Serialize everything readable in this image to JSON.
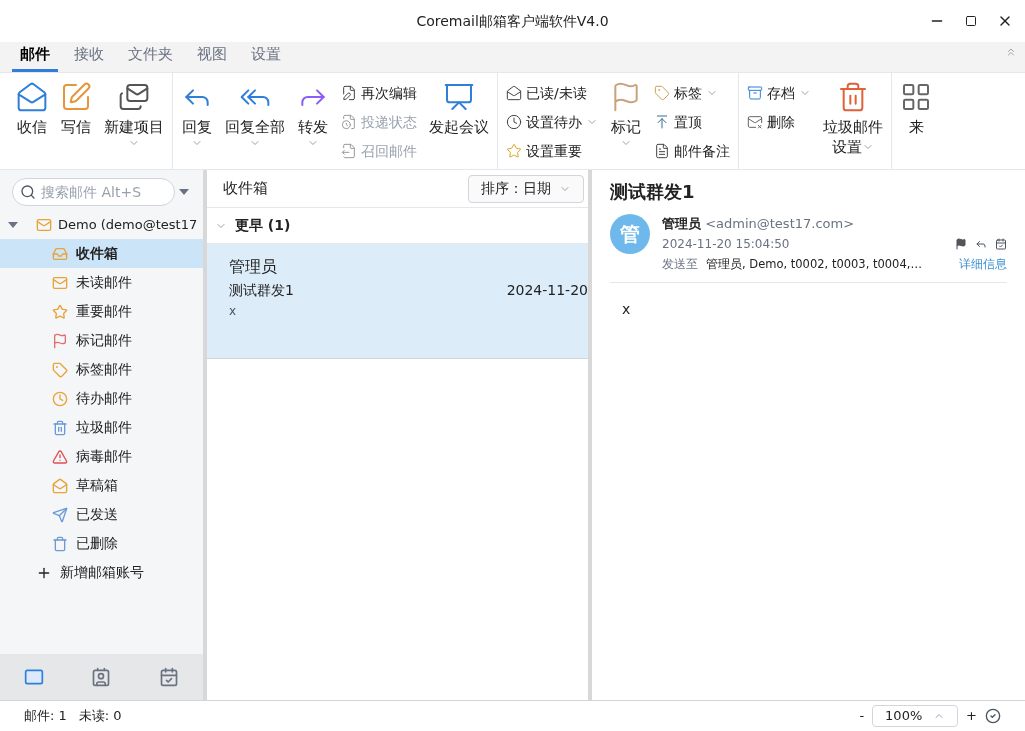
{
  "window": {
    "title": "Coremail邮箱客户端软件V4.0"
  },
  "tabs": [
    {
      "label": "邮件",
      "selected": true
    },
    {
      "label": "接收",
      "selected": false
    },
    {
      "label": "文件夹",
      "selected": false
    },
    {
      "label": "视图",
      "selected": false
    },
    {
      "label": "设置",
      "selected": false
    }
  ],
  "ribbon": [
    [
      {
        "kind": "big",
        "label": "收信",
        "dropdown": false
      },
      {
        "kind": "big",
        "label": "写信",
        "dropdown": false
      },
      {
        "kind": "big",
        "label": "新建项目",
        "dropdown": true
      }
    ],
    [
      {
        "kind": "big",
        "label": "回复",
        "dropdown": true
      },
      {
        "kind": "big",
        "label": "回复全部",
        "dropdown": true
      },
      {
        "kind": "big",
        "label": "转发",
        "dropdown": true
      },
      {
        "kind": "stack",
        "items": [
          {
            "label": "再次编辑",
            "disabled": false,
            "dropdown": false
          },
          {
            "label": "投递状态",
            "disabled": true,
            "dropdown": false
          },
          {
            "label": "召回邮件",
            "disabled": true,
            "dropdown": false
          }
        ]
      },
      {
        "kind": "big",
        "label": "发起会议",
        "dropdown": false
      }
    ],
    [
      {
        "kind": "stack",
        "items": [
          {
            "label": "已读/未读",
            "disabled": false,
            "dropdown": false
          },
          {
            "label": "设置待办",
            "disabled": false,
            "dropdown": true
          },
          {
            "label": "设置重要",
            "disabled": false,
            "dropdown": false
          }
        ]
      },
      {
        "kind": "big",
        "label": "标记",
        "dropdown": true
      },
      {
        "kind": "stack",
        "items": [
          {
            "label": "标签",
            "disabled": false,
            "dropdown": true
          },
          {
            "label": "置顶",
            "disabled": false,
            "dropdown": false
          },
          {
            "label": "邮件备注",
            "disabled": false,
            "dropdown": false
          }
        ]
      }
    ],
    [
      {
        "kind": "stack",
        "items": [
          {
            "label": "存档",
            "disabled": false,
            "dropdown": true
          },
          {
            "label": "删除",
            "disabled": false,
            "dropdown": false
          }
        ]
      },
      {
        "kind": "big",
        "label": "垃圾邮件",
        "label2": "设置",
        "dropdown": true
      }
    ],
    [
      {
        "kind": "big",
        "label": "来",
        "dropdown": false
      }
    ]
  ],
  "sidebar": {
    "search": {
      "placeholder": "搜索邮件 Alt+S"
    },
    "account": {
      "label": "Demo (demo@test17",
      "expanded": true
    },
    "folders": [
      {
        "label": "收件箱",
        "selected": true
      },
      {
        "label": "未读邮件",
        "selected": false
      },
      {
        "label": "重要邮件",
        "selected": false
      },
      {
        "label": "标记邮件",
        "selected": false
      },
      {
        "label": "标签邮件",
        "selected": false
      },
      {
        "label": "待办邮件",
        "selected": false
      },
      {
        "label": "垃圾邮件",
        "selected": false
      },
      {
        "label": "病毒邮件",
        "selected": false
      },
      {
        "label": "草稿箱",
        "selected": false
      },
      {
        "label": "已发送",
        "selected": false
      },
      {
        "label": "已删除",
        "selected": false
      }
    ],
    "add_account": "新增邮箱账号",
    "nav": [
      {
        "selected": true
      },
      {
        "selected": false
      },
      {
        "selected": false
      }
    ]
  },
  "message_list": {
    "title": "收件箱",
    "sort": "排序：日期",
    "group": {
      "label": "更早 (1)",
      "expanded": true
    },
    "messages": [
      {
        "sender": "管理员",
        "subject": "测试群发1",
        "date": "2024-11-20",
        "preview": "x",
        "selected": true
      }
    ]
  },
  "reader": {
    "subject": "测试群发1",
    "avatar": "管",
    "sender": "管理员",
    "email": "<admin@test17.com>",
    "time": "2024-11-20 15:04:50",
    "to_label": "发送至",
    "recipients": "管理员, Demo, t0002, t0003, t0004,…",
    "details_link": "详细信息",
    "body": "x"
  },
  "status_bar": {
    "mail_count": "邮件: 1",
    "unread": "未读: 0",
    "zoom_minus": "-",
    "zoom": "100%",
    "zoom_plus": "+"
  }
}
